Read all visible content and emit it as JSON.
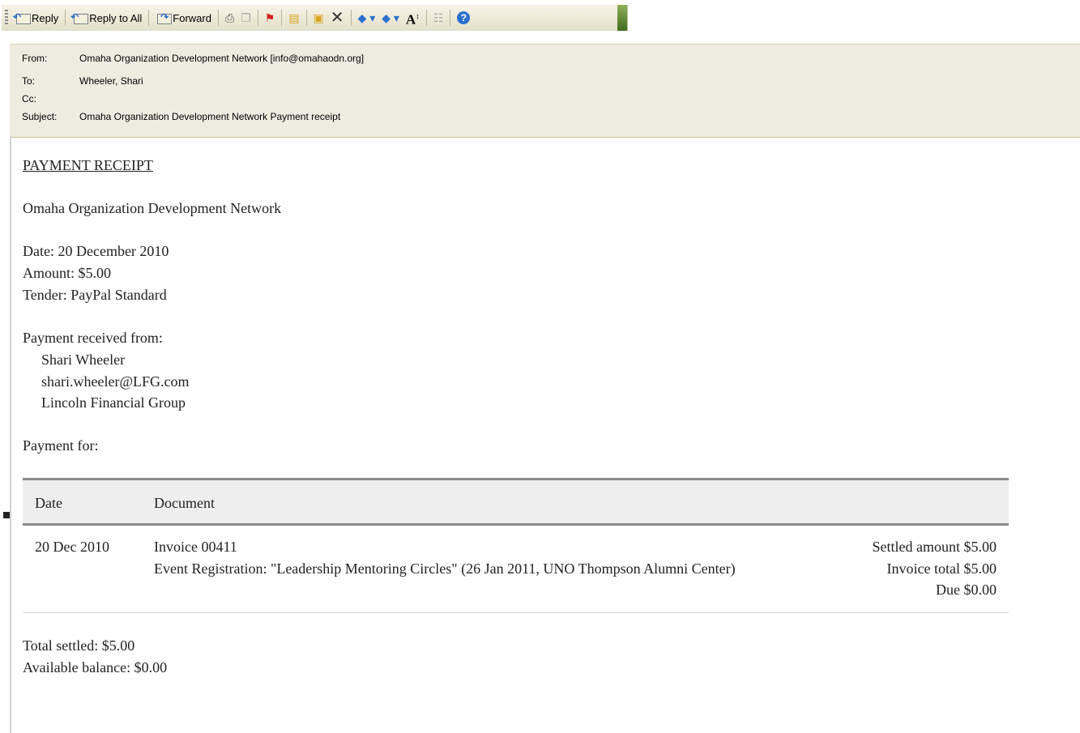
{
  "toolbar": {
    "reply": "Reply",
    "reply_all": "Reply to All",
    "forward": "Forward"
  },
  "header": {
    "from_label": "From:",
    "from_value": "Omaha Organization Development Network [info@omahaodn.org]",
    "to_label": "To:",
    "to_value": "Wheeler, Shari",
    "cc_label": "Cc:",
    "cc_value": "",
    "subject_label": "Subject:",
    "subject_value": "Omaha Organization Development Network Payment receipt"
  },
  "receipt": {
    "title": "PAYMENT RECEIPT",
    "org": "Omaha Organization Development Network",
    "date": "Date: 20 December 2010",
    "amount": "Amount: $5.00",
    "tender": "Tender: PayPal Standard",
    "received_from_label": "Payment received from:",
    "payer_name": "Shari Wheeler",
    "payer_email": "shari.wheeler@LFG.com",
    "payer_company": "Lincoln Financial Group",
    "payment_for_label": "Payment for:",
    "table": {
      "headers": [
        "Date",
        "Document"
      ],
      "row": {
        "date": "20 Dec 2010",
        "doc_line1": "Invoice 00411",
        "doc_line2": "Event Registration: \"Leadership Mentoring Circles\" (26 Jan 2011, UNO Thompson Alumni Center)",
        "settled": "Settled amount $5.00",
        "invoice_total": "Invoice total $5.00",
        "due": "Due $0.00"
      }
    },
    "total_settled": "Total settled: $5.00",
    "available_balance": "Available balance: $0.00"
  }
}
